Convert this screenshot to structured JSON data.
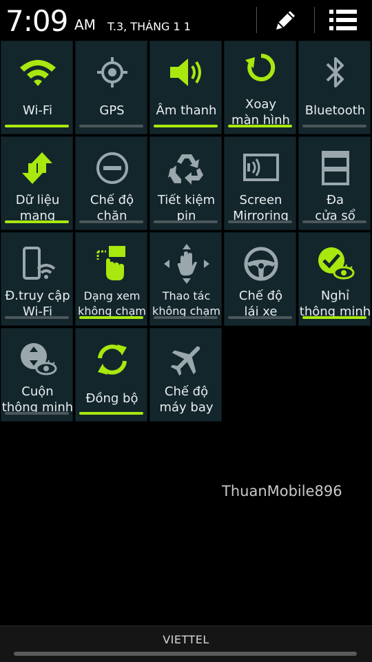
{
  "status_bar": {
    "time": "7:09",
    "ampm": "AM",
    "date": "T.3, THÁNG 1 1",
    "edit_icon": "pencil-icon",
    "list_icon": "list-icon"
  },
  "colors": {
    "accent": "#a8e80f",
    "tile_bg": "#13262c",
    "inactive": "#9aa8ad"
  },
  "tiles": [
    {
      "label": "Wi-Fi",
      "icon": "wifi-icon",
      "active": true
    },
    {
      "label": "GPS",
      "icon": "gps-icon",
      "active": false
    },
    {
      "label": "Âm thanh",
      "icon": "speaker-icon",
      "active": true
    },
    {
      "label": "Xoay màn hình",
      "line1": "Xoay",
      "line2": "màn hình",
      "icon": "rotate-icon",
      "active": true
    },
    {
      "label": "Bluetooth",
      "icon": "bluetooth-icon",
      "active": false
    },
    {
      "label": "Dữ liệu mạng",
      "line1": "Dữ liệu",
      "line2": "mạng",
      "icon": "data-arrows-icon",
      "active": true
    },
    {
      "label": "Chế độ chặn",
      "line1": "Chế độ",
      "line2": "chặn",
      "icon": "block-icon",
      "active": false
    },
    {
      "label": "Tiết kiệm pin",
      "line1": "Tiết kiệm",
      "line2": "pin",
      "icon": "recycle-icon",
      "active": false
    },
    {
      "label": "Screen Mirroring",
      "line1": "Screen",
      "line2": "Mirroring",
      "icon": "screen-mirroring-icon",
      "active": false
    },
    {
      "label": "Đa cửa sổ",
      "line1": "Đa",
      "line2": "cửa sổ",
      "icon": "multi-window-icon",
      "active": false
    },
    {
      "label": "Đ.truy cập Wi-Fi",
      "line1": "Đ.truy cập",
      "line2": "Wi-Fi",
      "icon": "hotspot-icon",
      "active": false
    },
    {
      "label": "Dạng xem không chạm",
      "line1": "Dạng xem",
      "line2": "không chạm",
      "icon": "air-view-icon",
      "active": true
    },
    {
      "label": "Thao tác không chạm",
      "line1": "Thao tác",
      "line2": "không chạm",
      "icon": "air-gesture-icon",
      "active": false
    },
    {
      "label": "Chế độ lái xe",
      "line1": "Chế độ",
      "line2": "lái xe",
      "icon": "steering-wheel-icon",
      "active": false
    },
    {
      "label": "Nghỉ thông minh",
      "line1": "Nghỉ",
      "line2": "thông minh",
      "icon": "smart-stay-icon",
      "active": true
    },
    {
      "label": "Cuộn thông minh",
      "line1": "Cuộn",
      "line2": "thông minh",
      "icon": "smart-scroll-icon",
      "active": false
    },
    {
      "label": "Đồng bộ",
      "icon": "sync-icon",
      "active": true
    },
    {
      "label": "Chế độ máy bay",
      "line1": "Chế độ",
      "line2": "máy bay",
      "icon": "airplane-icon",
      "active": false
    }
  ],
  "watermark": "ThuanMobile896",
  "carrier": "VIETTEL"
}
